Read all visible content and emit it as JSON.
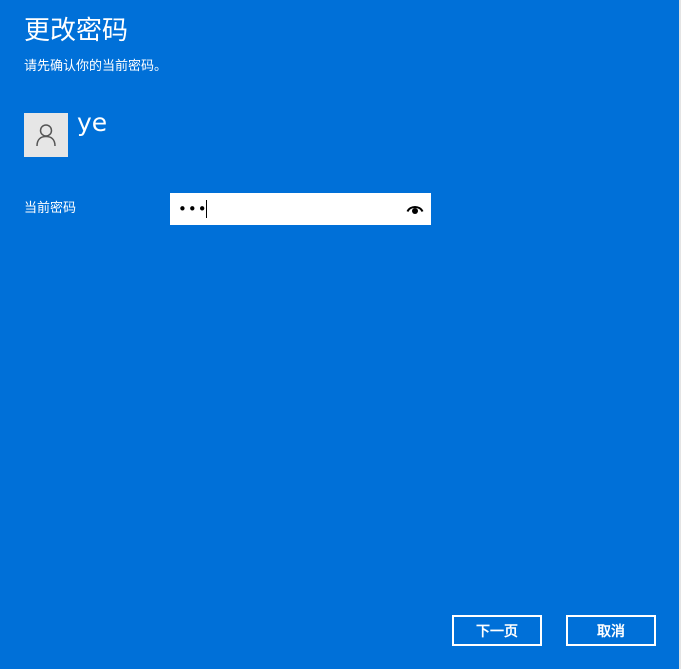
{
  "header": {
    "title": "更改密码",
    "subtitle": "请先确认你的当前密码。"
  },
  "user": {
    "name": "ye",
    "avatar_icon": "person-icon"
  },
  "form": {
    "current_password_label": "当前密码",
    "current_password_value": "•••",
    "reveal_icon": "eye-icon"
  },
  "footer": {
    "next_label": "下一页",
    "cancel_label": "取消"
  },
  "colors": {
    "background": "#0070d8",
    "text": "#ffffff",
    "input_background": "#ffffff",
    "avatar_background": "#e6e6e6"
  }
}
